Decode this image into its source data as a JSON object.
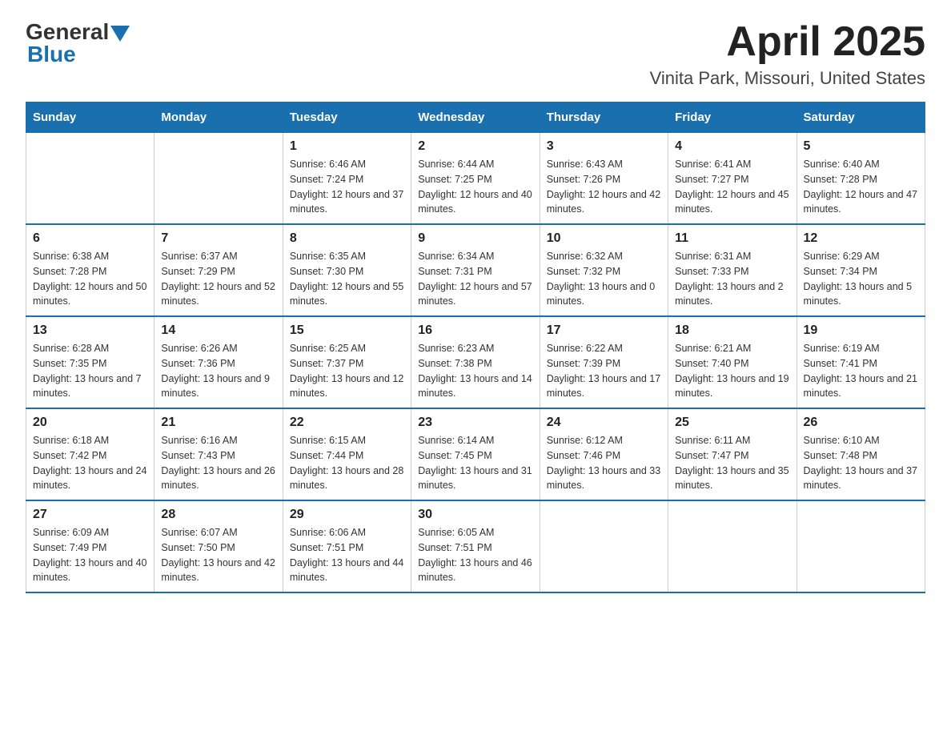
{
  "header": {
    "logo_general": "General",
    "logo_blue": "Blue",
    "title": "April 2025",
    "subtitle": "Vinita Park, Missouri, United States"
  },
  "calendar": {
    "days_of_week": [
      "Sunday",
      "Monday",
      "Tuesday",
      "Wednesday",
      "Thursday",
      "Friday",
      "Saturday"
    ],
    "weeks": [
      [
        {
          "day": null
        },
        {
          "day": null
        },
        {
          "day": "1",
          "sunrise": "Sunrise: 6:46 AM",
          "sunset": "Sunset: 7:24 PM",
          "daylight": "Daylight: 12 hours and 37 minutes."
        },
        {
          "day": "2",
          "sunrise": "Sunrise: 6:44 AM",
          "sunset": "Sunset: 7:25 PM",
          "daylight": "Daylight: 12 hours and 40 minutes."
        },
        {
          "day": "3",
          "sunrise": "Sunrise: 6:43 AM",
          "sunset": "Sunset: 7:26 PM",
          "daylight": "Daylight: 12 hours and 42 minutes."
        },
        {
          "day": "4",
          "sunrise": "Sunrise: 6:41 AM",
          "sunset": "Sunset: 7:27 PM",
          "daylight": "Daylight: 12 hours and 45 minutes."
        },
        {
          "day": "5",
          "sunrise": "Sunrise: 6:40 AM",
          "sunset": "Sunset: 7:28 PM",
          "daylight": "Daylight: 12 hours and 47 minutes."
        }
      ],
      [
        {
          "day": "6",
          "sunrise": "Sunrise: 6:38 AM",
          "sunset": "Sunset: 7:28 PM",
          "daylight": "Daylight: 12 hours and 50 minutes."
        },
        {
          "day": "7",
          "sunrise": "Sunrise: 6:37 AM",
          "sunset": "Sunset: 7:29 PM",
          "daylight": "Daylight: 12 hours and 52 minutes."
        },
        {
          "day": "8",
          "sunrise": "Sunrise: 6:35 AM",
          "sunset": "Sunset: 7:30 PM",
          "daylight": "Daylight: 12 hours and 55 minutes."
        },
        {
          "day": "9",
          "sunrise": "Sunrise: 6:34 AM",
          "sunset": "Sunset: 7:31 PM",
          "daylight": "Daylight: 12 hours and 57 minutes."
        },
        {
          "day": "10",
          "sunrise": "Sunrise: 6:32 AM",
          "sunset": "Sunset: 7:32 PM",
          "daylight": "Daylight: 13 hours and 0 minutes."
        },
        {
          "day": "11",
          "sunrise": "Sunrise: 6:31 AM",
          "sunset": "Sunset: 7:33 PM",
          "daylight": "Daylight: 13 hours and 2 minutes."
        },
        {
          "day": "12",
          "sunrise": "Sunrise: 6:29 AM",
          "sunset": "Sunset: 7:34 PM",
          "daylight": "Daylight: 13 hours and 5 minutes."
        }
      ],
      [
        {
          "day": "13",
          "sunrise": "Sunrise: 6:28 AM",
          "sunset": "Sunset: 7:35 PM",
          "daylight": "Daylight: 13 hours and 7 minutes."
        },
        {
          "day": "14",
          "sunrise": "Sunrise: 6:26 AM",
          "sunset": "Sunset: 7:36 PM",
          "daylight": "Daylight: 13 hours and 9 minutes."
        },
        {
          "day": "15",
          "sunrise": "Sunrise: 6:25 AM",
          "sunset": "Sunset: 7:37 PM",
          "daylight": "Daylight: 13 hours and 12 minutes."
        },
        {
          "day": "16",
          "sunrise": "Sunrise: 6:23 AM",
          "sunset": "Sunset: 7:38 PM",
          "daylight": "Daylight: 13 hours and 14 minutes."
        },
        {
          "day": "17",
          "sunrise": "Sunrise: 6:22 AM",
          "sunset": "Sunset: 7:39 PM",
          "daylight": "Daylight: 13 hours and 17 minutes."
        },
        {
          "day": "18",
          "sunrise": "Sunrise: 6:21 AM",
          "sunset": "Sunset: 7:40 PM",
          "daylight": "Daylight: 13 hours and 19 minutes."
        },
        {
          "day": "19",
          "sunrise": "Sunrise: 6:19 AM",
          "sunset": "Sunset: 7:41 PM",
          "daylight": "Daylight: 13 hours and 21 minutes."
        }
      ],
      [
        {
          "day": "20",
          "sunrise": "Sunrise: 6:18 AM",
          "sunset": "Sunset: 7:42 PM",
          "daylight": "Daylight: 13 hours and 24 minutes."
        },
        {
          "day": "21",
          "sunrise": "Sunrise: 6:16 AM",
          "sunset": "Sunset: 7:43 PM",
          "daylight": "Daylight: 13 hours and 26 minutes."
        },
        {
          "day": "22",
          "sunrise": "Sunrise: 6:15 AM",
          "sunset": "Sunset: 7:44 PM",
          "daylight": "Daylight: 13 hours and 28 minutes."
        },
        {
          "day": "23",
          "sunrise": "Sunrise: 6:14 AM",
          "sunset": "Sunset: 7:45 PM",
          "daylight": "Daylight: 13 hours and 31 minutes."
        },
        {
          "day": "24",
          "sunrise": "Sunrise: 6:12 AM",
          "sunset": "Sunset: 7:46 PM",
          "daylight": "Daylight: 13 hours and 33 minutes."
        },
        {
          "day": "25",
          "sunrise": "Sunrise: 6:11 AM",
          "sunset": "Sunset: 7:47 PM",
          "daylight": "Daylight: 13 hours and 35 minutes."
        },
        {
          "day": "26",
          "sunrise": "Sunrise: 6:10 AM",
          "sunset": "Sunset: 7:48 PM",
          "daylight": "Daylight: 13 hours and 37 minutes."
        }
      ],
      [
        {
          "day": "27",
          "sunrise": "Sunrise: 6:09 AM",
          "sunset": "Sunset: 7:49 PM",
          "daylight": "Daylight: 13 hours and 40 minutes."
        },
        {
          "day": "28",
          "sunrise": "Sunrise: 6:07 AM",
          "sunset": "Sunset: 7:50 PM",
          "daylight": "Daylight: 13 hours and 42 minutes."
        },
        {
          "day": "29",
          "sunrise": "Sunrise: 6:06 AM",
          "sunset": "Sunset: 7:51 PM",
          "daylight": "Daylight: 13 hours and 44 minutes."
        },
        {
          "day": "30",
          "sunrise": "Sunrise: 6:05 AM",
          "sunset": "Sunset: 7:51 PM",
          "daylight": "Daylight: 13 hours and 46 minutes."
        },
        {
          "day": null
        },
        {
          "day": null
        },
        {
          "day": null
        }
      ]
    ]
  }
}
